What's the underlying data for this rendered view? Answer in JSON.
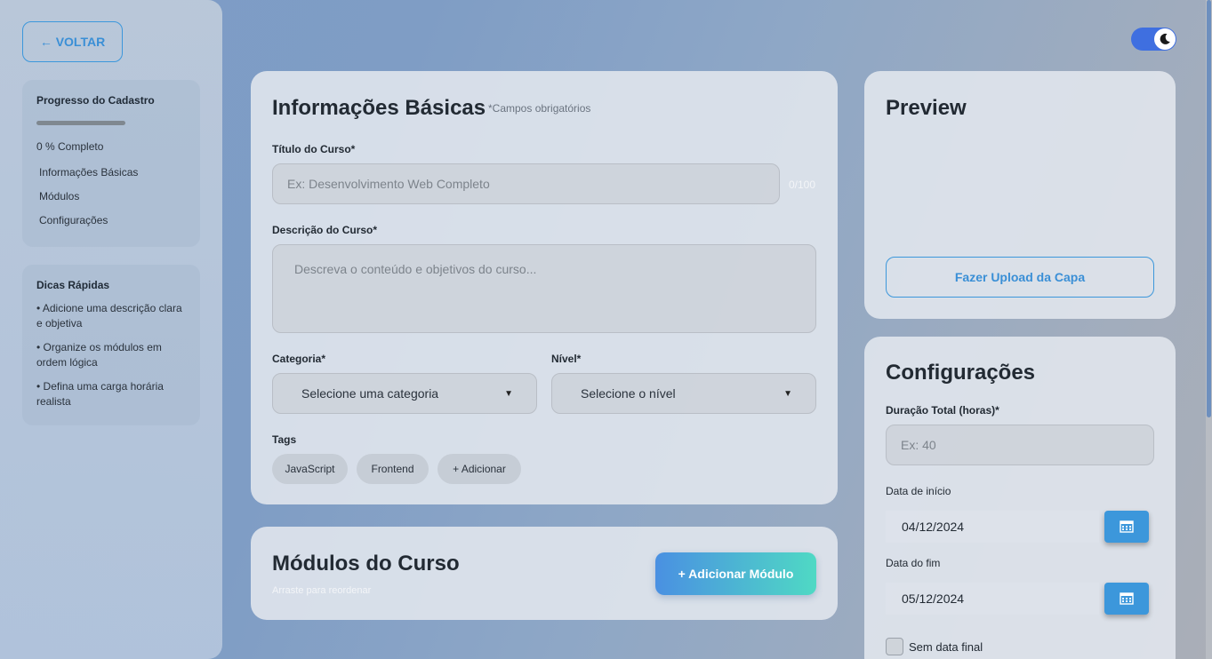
{
  "sidebar": {
    "back_label": "← VOLTAR",
    "progress": {
      "title": "Progresso do Cadastro",
      "percent_value": 0,
      "percent_text": "0 % Completo",
      "steps": [
        "Informações Básicas",
        "Módulos",
        "Configurações"
      ]
    },
    "tips": {
      "title": "Dicas Rápidas",
      "items": [
        "• Adicione uma descrição clara e objetiva",
        "• Organize os módulos em ordem lógica",
        "• Defina uma carga horária realista"
      ]
    }
  },
  "theme_toggle": {
    "state": "dark",
    "icon": "moon-icon"
  },
  "basic_info": {
    "title": "Informações Básicas",
    "required_note": "*Campos obrigatórios",
    "course_title_label": "Título do Curso*",
    "course_title_placeholder": "Ex: Desenvolvimento Web Completo",
    "course_title_counter": "0/100",
    "description_label": "Descrição do Curso*",
    "description_placeholder": "Descreva o conteúdo e objetivos do curso...",
    "category_label": "Categoria*",
    "category_value": "Selecione uma categoria",
    "level_label": "Nível*",
    "level_value": "Selecione o nível",
    "tags_label": "Tags",
    "tags": [
      "JavaScript",
      "Frontend",
      "+ Adicionar"
    ]
  },
  "modules": {
    "title": "Módulos do Curso",
    "subtitle": "Arraste para reordenar",
    "add_label": "+ Adicionar Módulo"
  },
  "preview": {
    "title": "Preview",
    "upload_label": "Fazer Upload da Capa"
  },
  "config": {
    "title": "Configurações",
    "duration_label": "Duração Total (horas)*",
    "duration_placeholder": "Ex: 40",
    "start_label": "Data de início",
    "start_value": "04/12/2024",
    "end_label": "Data do fim",
    "end_value": "05/12/2024",
    "no_end_label": "Sem data final"
  },
  "colors": {
    "accent": "#3c97db",
    "toggle": "#3f6fe0",
    "gradient_start": "#4a90e2",
    "gradient_end": "#4fd9c4"
  }
}
